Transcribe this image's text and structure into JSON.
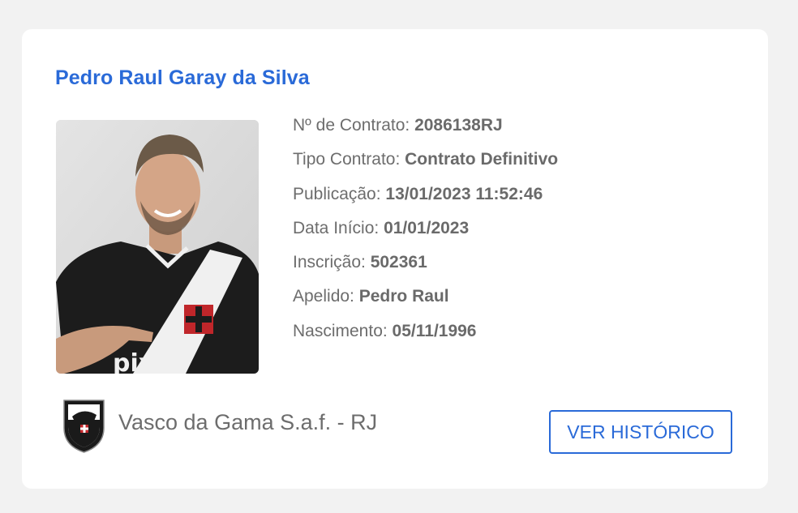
{
  "player": {
    "name": "Pedro Raul Garay da Silva"
  },
  "details": [
    {
      "label": "Nº de Contrato: ",
      "value": "2086138RJ"
    },
    {
      "label": "Tipo Contrato: ",
      "value": "Contrato Definitivo"
    },
    {
      "label": "Publicação: ",
      "value": "13/01/2023 11:52:46"
    },
    {
      "label": "Data Início: ",
      "value": "01/01/2023"
    },
    {
      "label": "Inscrição: ",
      "value": "502361"
    },
    {
      "label": "Apelido: ",
      "value": "Pedro Raul"
    },
    {
      "label": "Nascimento: ",
      "value": "05/11/1996"
    }
  ],
  "club": {
    "name": "Vasco da Gama S.a.f. - RJ",
    "crest_icon": "vasco-crest-icon"
  },
  "actions": {
    "history_button": "VER HISTÓRICO"
  },
  "colors": {
    "accent": "#2a6ad8",
    "text": "#6d6d6d",
    "background": "#f2f2f2",
    "card": "#ffffff"
  }
}
